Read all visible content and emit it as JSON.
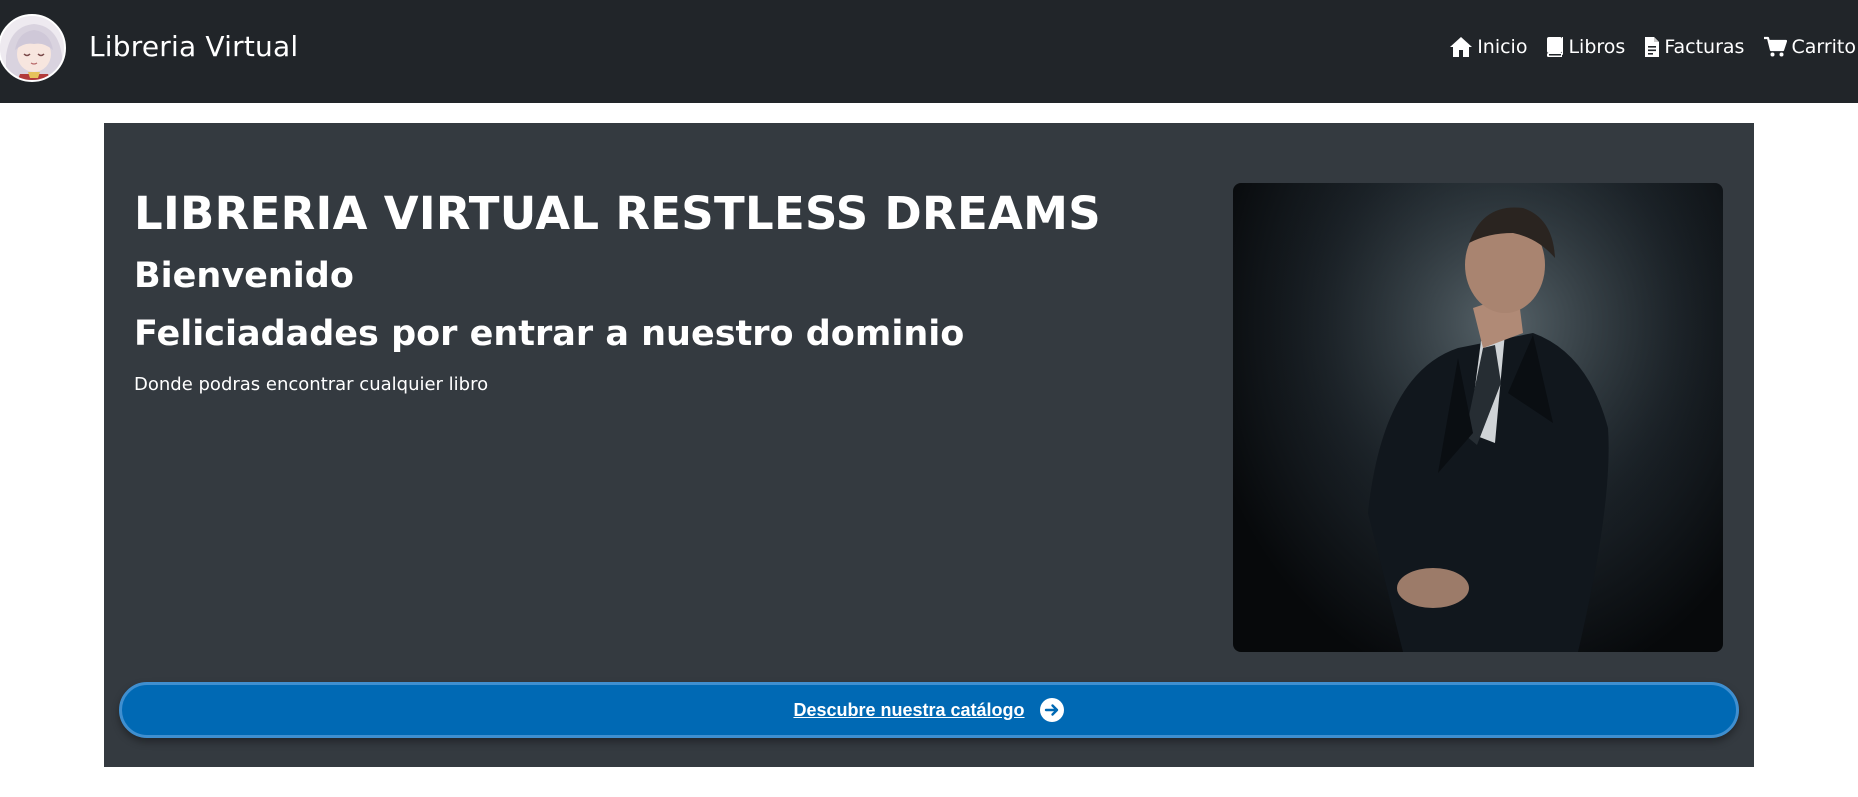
{
  "brand": {
    "title": "Libreria Virtual"
  },
  "nav": {
    "items": [
      {
        "label": "Inicio",
        "icon": "home-icon"
      },
      {
        "label": "Libros",
        "icon": "book-icon"
      },
      {
        "label": "Facturas",
        "icon": "document-icon"
      },
      {
        "label": "Carrito",
        "icon": "cart-icon"
      }
    ]
  },
  "hero": {
    "title": "LIBRERIA VIRTUAL RESTLESS DREAMS",
    "welcome": "Bienvenido",
    "subtitle": "Feliciadades por entrar a nuestro dominio",
    "text": "Donde podras encontrar cualquier libro",
    "cta_label": "Descubre nuestra catálogo"
  },
  "colors": {
    "navbar": "#212529",
    "hero": "#343a40",
    "cta": "#0069b4"
  }
}
